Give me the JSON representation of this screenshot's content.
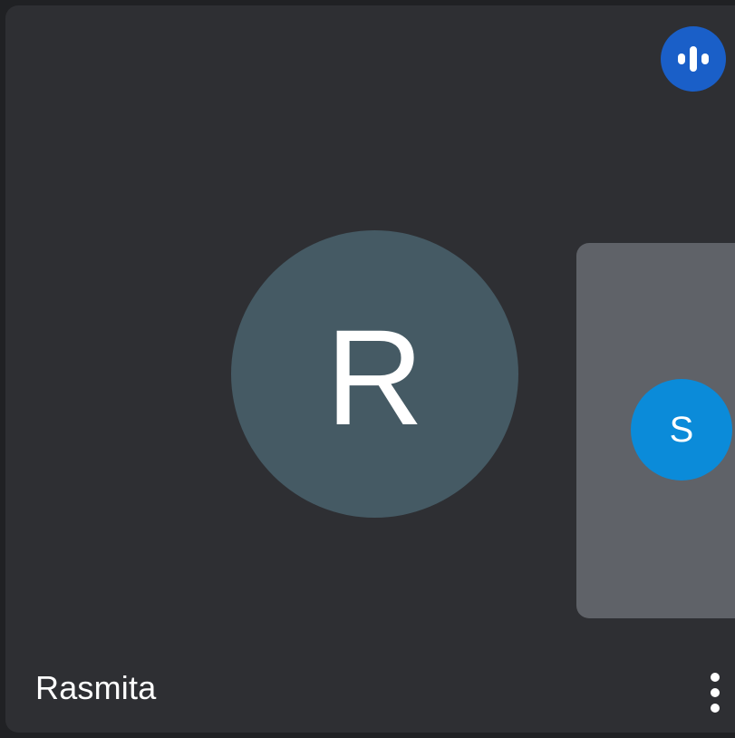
{
  "participant": {
    "name": "Rasmita",
    "initial": "R",
    "avatar_color": "#455a64",
    "speaking_icon": "audio-level-icon",
    "speaking_badge_color": "#1a5fc8"
  },
  "self_view": {
    "initial": "S",
    "avatar_color": "#0b8bd9",
    "background_color": "#5f6268"
  },
  "controls": {
    "more_icon": "more-vert-icon"
  },
  "colors": {
    "tile_background": "#2e2f33",
    "page_background": "#202124"
  }
}
